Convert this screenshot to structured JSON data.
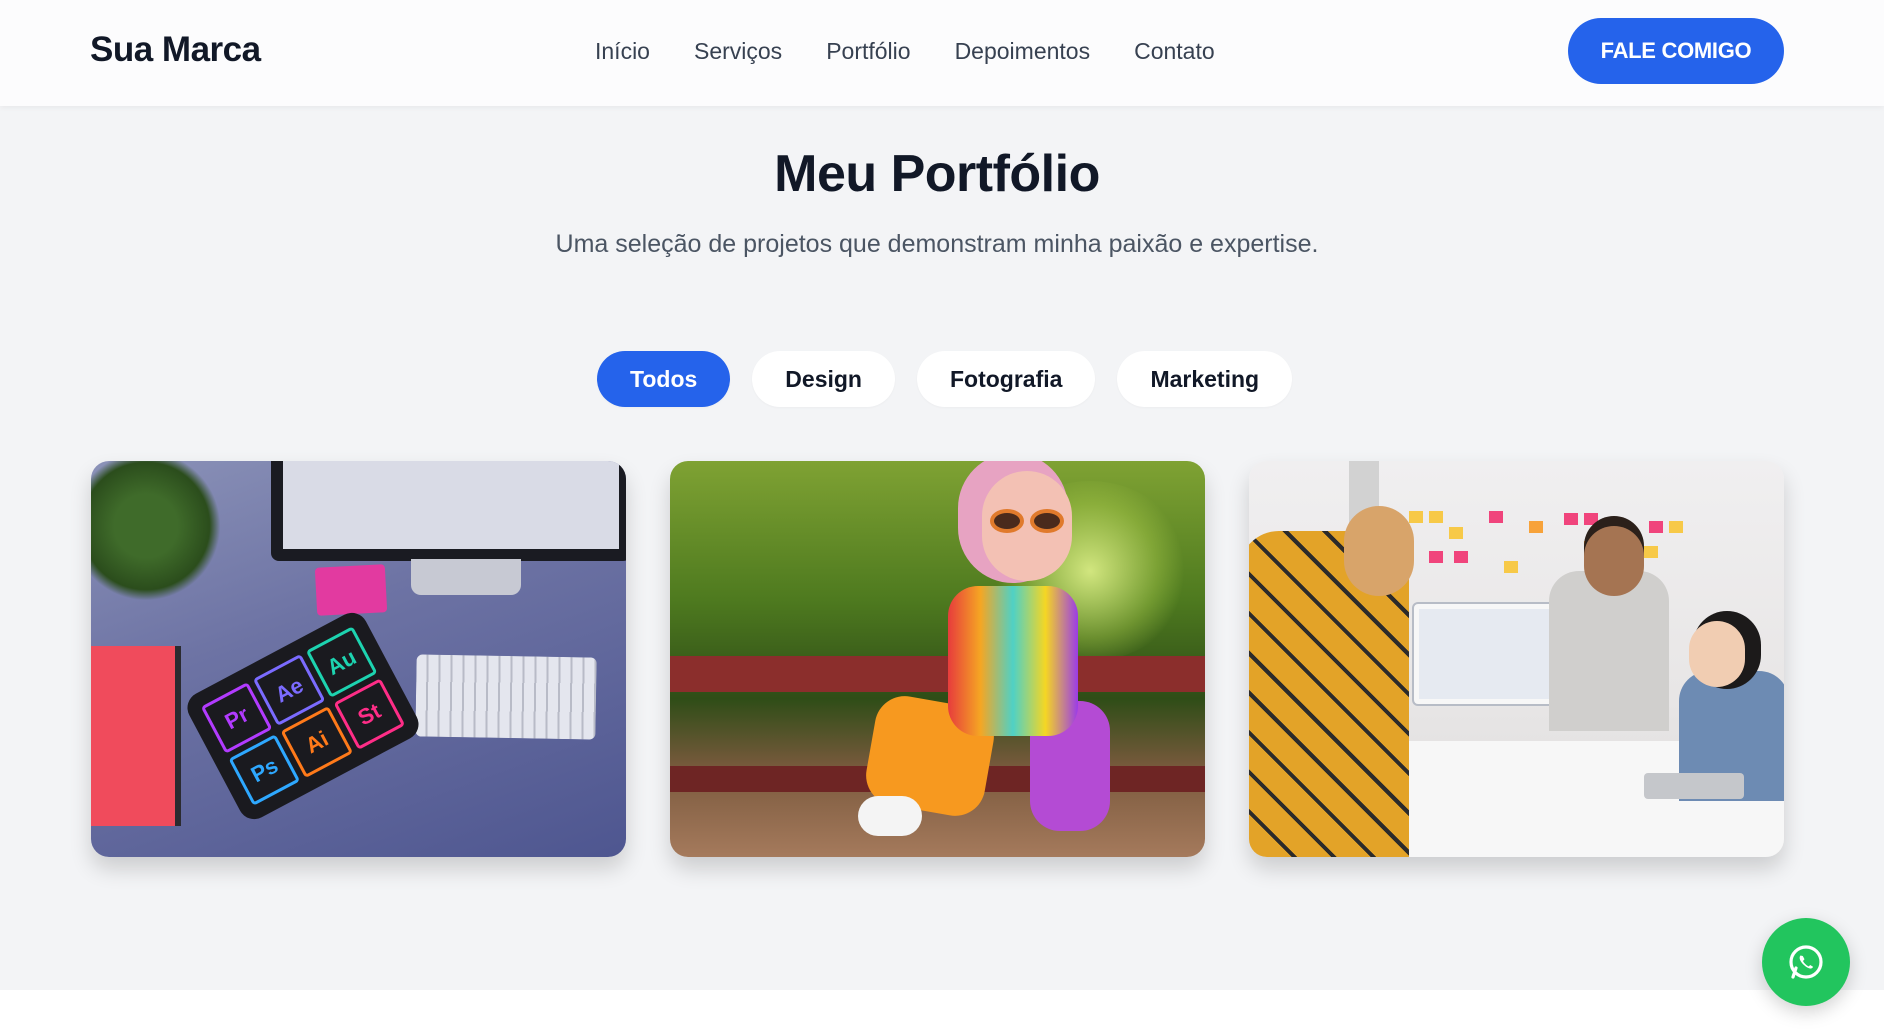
{
  "header": {
    "brand": "Sua Marca",
    "nav": [
      "Início",
      "Serviços",
      "Portfólio",
      "Depoimentos",
      "Contato"
    ],
    "cta_label": "FALE COMIGO"
  },
  "portfolio": {
    "title": "Meu Portfólio",
    "subtitle": "Uma seleção de projetos que demonstram minha paixão e expertise.",
    "filters": [
      {
        "label": "Todos",
        "active": true
      },
      {
        "label": "Design",
        "active": false
      },
      {
        "label": "Fotografia",
        "active": false
      },
      {
        "label": "Marketing",
        "active": false
      }
    ],
    "items": [
      {
        "image": "design-desk-tablet-photo"
      },
      {
        "image": "fashion-park-bench-photo"
      },
      {
        "image": "office-team-meeting-photo"
      }
    ]
  },
  "floating": {
    "icon": "whatsapp-icon"
  },
  "colors": {
    "accent": "#2563eb",
    "whatsapp": "#22c55e",
    "background": "#f3f4f6",
    "heading": "#111827",
    "text": "#4b5563"
  }
}
